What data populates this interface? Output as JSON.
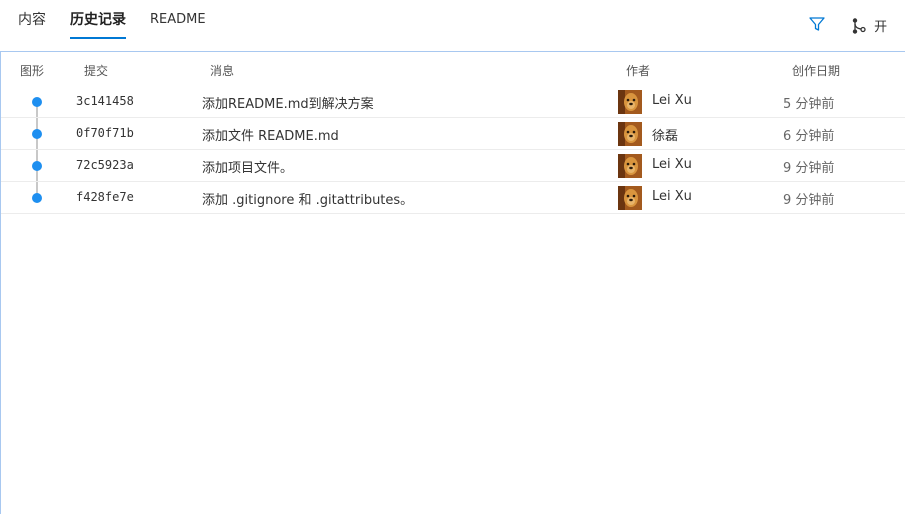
{
  "tabs": {
    "contents": "内容",
    "history": "历史记录",
    "readme": "README"
  },
  "toolbar": {
    "filter_icon": "filter-icon",
    "toggle_icon": "branch-graph-icon",
    "toggle_label": "开"
  },
  "table": {
    "headers": {
      "graph": "图形",
      "commit": "提交",
      "message": "消息",
      "author": "作者",
      "date": "创作日期"
    },
    "rows": [
      {
        "commit": "3c141458",
        "message": "添加README.md到解决方案",
        "author": "Lei Xu",
        "date": "5 分钟前"
      },
      {
        "commit": "0f70f71b",
        "message": "添加文件 README.md",
        "author": "徐磊",
        "date": "6 分钟前"
      },
      {
        "commit": "72c5923a",
        "message": "添加项目文件。",
        "author": "Lei Xu",
        "date": "9 分钟前"
      },
      {
        "commit": "f428fe7e",
        "message": "添加 .gitignore 和 .gitattributes。",
        "author": "Lei Xu",
        "date": "9 分钟前"
      }
    ]
  },
  "colors": {
    "accent": "#0078d4",
    "graph_dot": "#1e8ff0",
    "panel_border": "#a8c8f0"
  }
}
